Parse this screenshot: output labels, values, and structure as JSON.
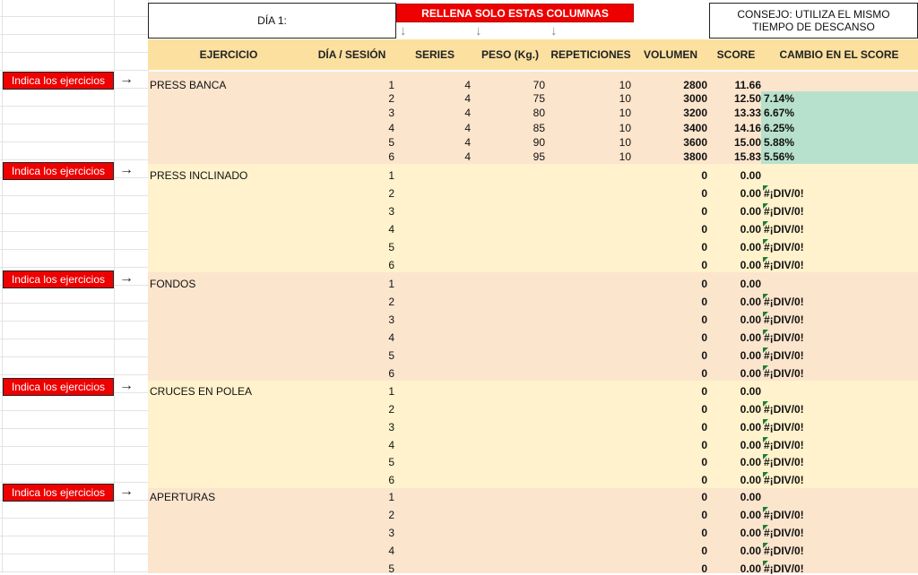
{
  "header": {
    "day_label": "DÍA 1:",
    "banner": "RELLENA SOLO ESTAS COLUMNAS",
    "tip": "CONSEJO: UTILIZA EL MISMO TIEMPO DE DESCANSO",
    "tip_line1": "CONSEJO: UTILIZA EL MISMO",
    "tip_line2": "TIEMPO DE DESCANSO",
    "down_arrow": "↓"
  },
  "columns": [
    "EJERCICIO",
    "DÍA / SESIÓN",
    "SERIES",
    "PESO (Kg.)",
    "REPETICIONES",
    "VOLUMEN",
    "SCORE",
    "CAMBIO EN EL SCORE"
  ],
  "side_tag": {
    "label": "Indica los ejercicios",
    "arrow": "→"
  },
  "exercises": [
    {
      "name": "PRESS BANCA",
      "rows": [
        {
          "session": "1",
          "series": "4",
          "weight": "70",
          "reps": "10",
          "volume": "2800",
          "score": "11.66",
          "change": ""
        },
        {
          "session": "2",
          "series": "4",
          "weight": "75",
          "reps": "10",
          "volume": "3000",
          "score": "12.50",
          "change": "7.14%"
        },
        {
          "session": "3",
          "series": "4",
          "weight": "80",
          "reps": "10",
          "volume": "3200",
          "score": "13.33",
          "change": "6.67%"
        },
        {
          "session": "4",
          "series": "4",
          "weight": "85",
          "reps": "10",
          "volume": "3400",
          "score": "14.16",
          "change": "6.25%"
        },
        {
          "session": "5",
          "series": "4",
          "weight": "90",
          "reps": "10",
          "volume": "3600",
          "score": "15.00",
          "change": "5.88%"
        },
        {
          "session": "6",
          "series": "4",
          "weight": "95",
          "reps": "10",
          "volume": "3800",
          "score": "15.83",
          "change": "5.56%"
        }
      ]
    },
    {
      "name": "PRESS INCLINADO",
      "rows": [
        {
          "session": "1",
          "volume": "0",
          "score": "0.00",
          "change": ""
        },
        {
          "session": "2",
          "volume": "0",
          "score": "0.00",
          "change": "#¡DIV/0!"
        },
        {
          "session": "3",
          "volume": "0",
          "score": "0.00",
          "change": "#¡DIV/0!"
        },
        {
          "session": "4",
          "volume": "0",
          "score": "0.00",
          "change": "#¡DIV/0!"
        },
        {
          "session": "5",
          "volume": "0",
          "score": "0.00",
          "change": "#¡DIV/0!"
        },
        {
          "session": "6",
          "volume": "0",
          "score": "0.00",
          "change": "#¡DIV/0!"
        }
      ]
    },
    {
      "name": "FONDOS",
      "rows": [
        {
          "session": "1",
          "volume": "0",
          "score": "0.00",
          "change": ""
        },
        {
          "session": "2",
          "volume": "0",
          "score": "0.00",
          "change": "#¡DIV/0!"
        },
        {
          "session": "3",
          "volume": "0",
          "score": "0.00",
          "change": "#¡DIV/0!"
        },
        {
          "session": "4",
          "volume": "0",
          "score": "0.00",
          "change": "#¡DIV/0!"
        },
        {
          "session": "5",
          "volume": "0",
          "score": "0.00",
          "change": "#¡DIV/0!"
        },
        {
          "session": "6",
          "volume": "0",
          "score": "0.00",
          "change": "#¡DIV/0!"
        }
      ]
    },
    {
      "name": "CRUCES EN POLEA",
      "rows": [
        {
          "session": "1",
          "volume": "0",
          "score": "0.00",
          "change": ""
        },
        {
          "session": "2",
          "volume": "0",
          "score": "0.00",
          "change": "#¡DIV/0!"
        },
        {
          "session": "3",
          "volume": "0",
          "score": "0.00",
          "change": "#¡DIV/0!"
        },
        {
          "session": "4",
          "volume": "0",
          "score": "0.00",
          "change": "#¡DIV/0!"
        },
        {
          "session": "5",
          "volume": "0",
          "score": "0.00",
          "change": "#¡DIV/0!"
        },
        {
          "session": "6",
          "volume": "0",
          "score": "0.00",
          "change": "#¡DIV/0!"
        }
      ]
    },
    {
      "name": "APERTURAS",
      "rows": [
        {
          "session": "1",
          "volume": "0",
          "score": "0.00",
          "change": ""
        },
        {
          "session": "2",
          "volume": "0",
          "score": "0.00",
          "change": "#¡DIV/0!"
        },
        {
          "session": "3",
          "volume": "0",
          "score": "0.00",
          "change": "#¡DIV/0!"
        },
        {
          "session": "4",
          "volume": "0",
          "score": "0.00",
          "change": "#¡DIV/0!"
        },
        {
          "session": "5",
          "volume": "0",
          "score": "0.00",
          "change": "#¡DIV/0!"
        }
      ]
    }
  ],
  "colors": {
    "header_band": "#fbe0a0",
    "peach_band": "#fce5cd",
    "cream_band": "#fff2cc",
    "change_highlight": "#b7e1cd",
    "accent_red": "#ee0000"
  }
}
